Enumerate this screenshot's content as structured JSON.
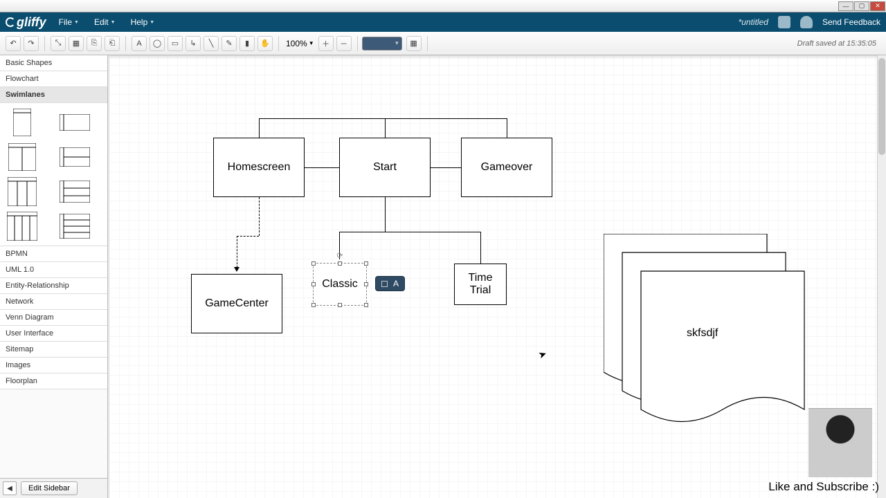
{
  "window": {
    "document_title": "*untitled"
  },
  "menus": {
    "file": "File",
    "edit": "Edit",
    "help": "Help",
    "feedback": "Send Feedback"
  },
  "toolbar": {
    "zoom": "100%",
    "draft_status": "Draft saved at 15:35:05"
  },
  "sidebar": {
    "categories_top": [
      "Basic Shapes",
      "Flowchart"
    ],
    "active_category": "Swimlanes",
    "categories_bottom": [
      "BPMN",
      "UML 1.0",
      "Entity-Relationship",
      "Network",
      "Venn Diagram",
      "User Interface",
      "Sitemap",
      "Images",
      "Floorplan"
    ],
    "edit_label": "Edit Sidebar"
  },
  "diagram": {
    "boxes": {
      "homescreen": "Homescreen",
      "start": "Start",
      "gameover": "Gameover",
      "gamecenter": "GameCenter",
      "classic": "Classic",
      "timetrial": "Time\nTrial",
      "docstack": "skfsdjf"
    },
    "tooltip_letter": "A"
  },
  "footer": {
    "cta": "Like and Subscribe :)"
  }
}
